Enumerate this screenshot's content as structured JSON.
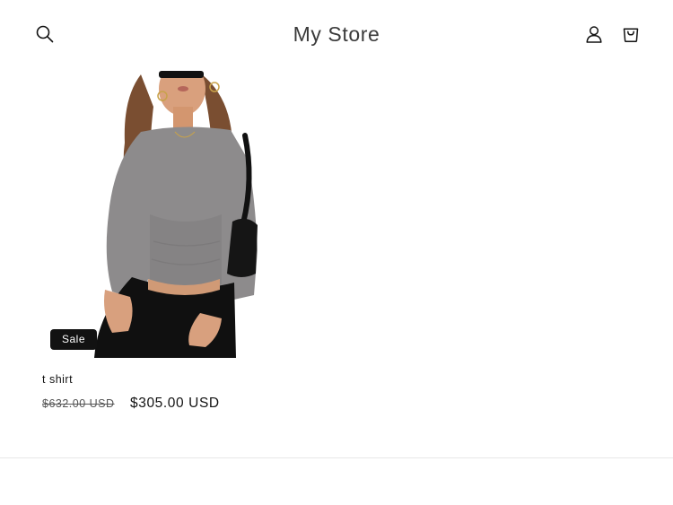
{
  "header": {
    "store_name": "My Store",
    "search_icon": "search-icon",
    "account_icon": "account-icon",
    "cart_icon": "cart-icon"
  },
  "product": {
    "title": "t shirt",
    "badge": "Sale",
    "compare_price": "$632.00 USD",
    "sale_price": "$305.00 USD"
  },
  "colors": {
    "text": "#121212",
    "badge_bg": "#121212",
    "badge_text": "#ffffff",
    "divider": "#e8e8e8"
  }
}
